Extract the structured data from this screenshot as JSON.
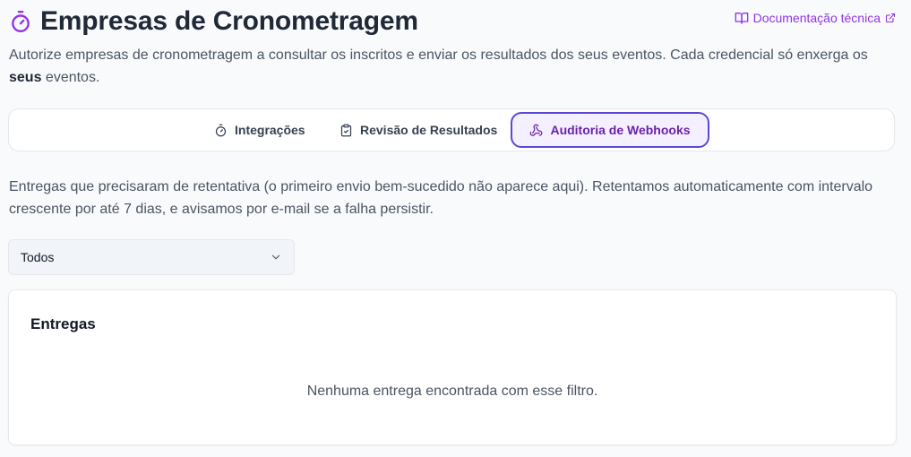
{
  "header": {
    "title": "Empresas de Cronometragem",
    "title_icon": "stopwatch-icon",
    "doc_link": {
      "label": "Documentação técnica",
      "icon": "book-open-icon",
      "external_icon": "external-link-icon"
    }
  },
  "intro": {
    "text_before": "Autorize empresas de cronometragem a consultar os inscritos e enviar os resultados dos seus eventos. Cada credencial só enxerga os ",
    "bold": "seus",
    "text_after": " eventos."
  },
  "tabs": [
    {
      "label": "Integrações",
      "icon": "stopwatch-icon",
      "active": false
    },
    {
      "label": "Revisão de Resultados",
      "icon": "clipboard-check-icon",
      "active": false
    },
    {
      "label": "Auditoria de Webhooks",
      "icon": "webhook-icon",
      "active": true
    }
  ],
  "description": "Entregas que precisaram de retentativa (o primeiro envio bem-sucedido não aparece aqui). Retentamos automaticamente com intervalo crescente por até 7 dias, e avisamos por e-mail se a falha persistir.",
  "filter": {
    "selected": "Todos",
    "icon": "chevron-down-icon"
  },
  "deliveries": {
    "title": "Entregas",
    "empty_message": "Nenhuma entrega encontrada com esse filtro."
  },
  "colors": {
    "accent": "#9333ea",
    "active_tab_border": "#5b49d6",
    "active_tab_text": "#6b21a8"
  }
}
